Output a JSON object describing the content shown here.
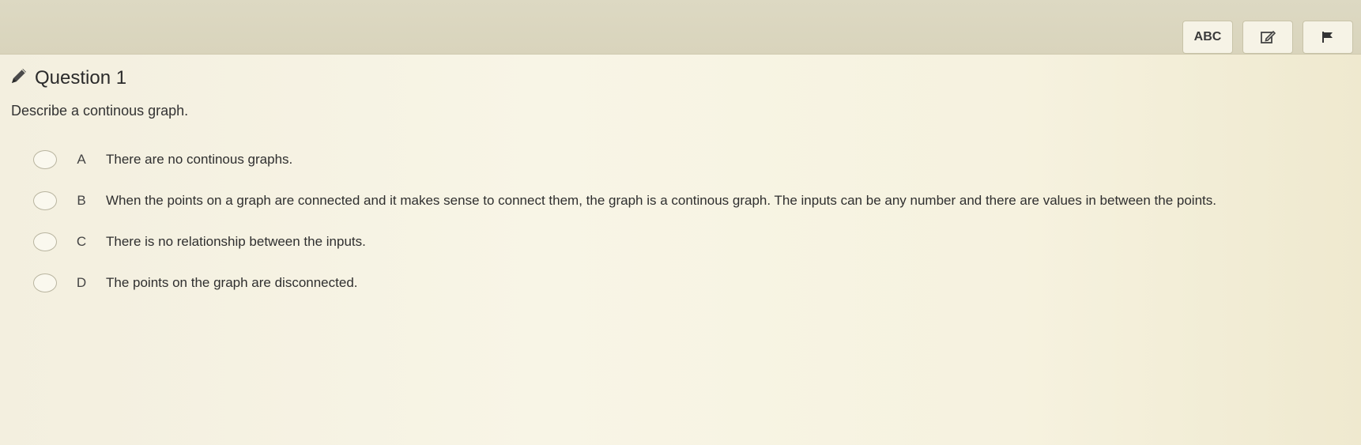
{
  "toolbar": {
    "spellcheck_label": "ABC",
    "notes_icon": "edit-icon",
    "flag_icon": "flag-icon"
  },
  "question": {
    "icon": "pencil-icon",
    "title": "Question 1",
    "prompt": "Describe a continous graph."
  },
  "options": [
    {
      "letter": "A",
      "text": "There are no continous graphs."
    },
    {
      "letter": "B",
      "text": "When the points on a graph are connected and it makes sense to connect them, the graph is a continous graph.  The inputs can be any number and there are values in between the points."
    },
    {
      "letter": "C",
      "text": "There is no relationship between the inputs."
    },
    {
      "letter": "D",
      "text": "The points on the graph are disconnected."
    }
  ]
}
